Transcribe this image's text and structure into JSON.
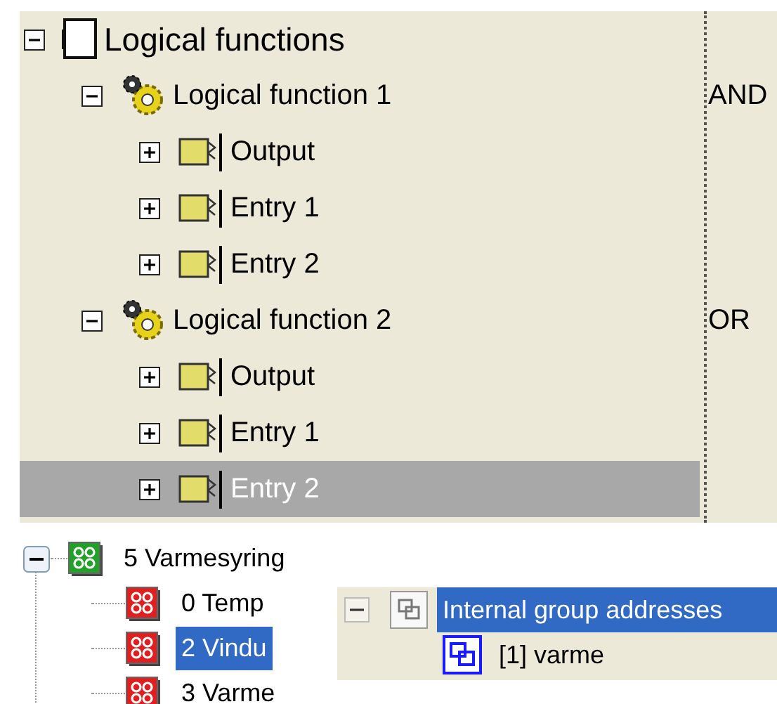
{
  "logic_tree": {
    "nodes": [
      {
        "label": "Logical functions",
        "kind": "root",
        "expanded": true,
        "selected": false,
        "children": [
          {
            "label": "Logical function 1",
            "kind": "function",
            "value": "AND",
            "expanded": true,
            "selected": false,
            "children": [
              {
                "label": "Output",
                "kind": "object",
                "expanded": false,
                "selected": false
              },
              {
                "label": "Entry 1",
                "kind": "object",
                "expanded": false,
                "selected": false
              },
              {
                "label": "Entry 2",
                "kind": "object",
                "expanded": false,
                "selected": false
              }
            ]
          },
          {
            "label": "Logical function 2",
            "kind": "function",
            "value": "OR",
            "expanded": true,
            "selected": false,
            "children": [
              {
                "label": "Output",
                "kind": "object",
                "expanded": false,
                "selected": false
              },
              {
                "label": "Entry 1",
                "kind": "object",
                "expanded": false,
                "selected": false
              },
              {
                "label": "Entry 2",
                "kind": "object",
                "expanded": false,
                "selected": true
              }
            ]
          }
        ]
      }
    ]
  },
  "group_tree": {
    "label": "5 Varmesyring",
    "expanded": true,
    "selected": false,
    "children": [
      {
        "label": "0 Temp",
        "selected": false
      },
      {
        "label": "2 Vindu",
        "selected": true
      },
      {
        "label": "3 Varme",
        "selected": false
      }
    ]
  },
  "address_panel": {
    "label": "Internal group addresses",
    "expanded": true,
    "selected": true,
    "children": [
      {
        "label": "[1] varme",
        "selected": false
      }
    ]
  }
}
